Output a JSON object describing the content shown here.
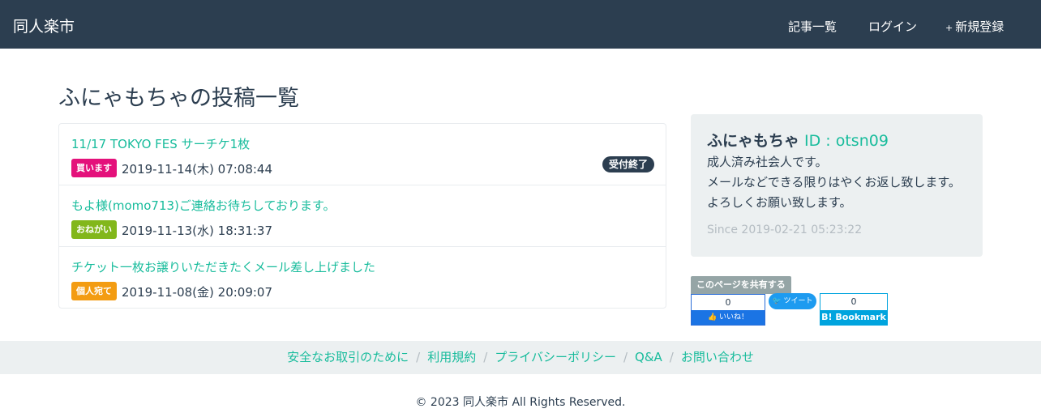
{
  "nav": {
    "brand": "同人楽市",
    "links": [
      {
        "icon": "",
        "label": "記事一覧",
        "icon_name": "list-icon"
      },
      {
        "icon": "",
        "label": "ログイン",
        "icon_name": "login-icon"
      },
      {
        "icon": "+",
        "label": "新規登録",
        "icon_name": "plus-icon"
      }
    ]
  },
  "page_title": "ふにゃもちゃの投稿一覧",
  "posts": [
    {
      "title": "11/17 TOKYO FES サーチケ1枚",
      "badge": "買います",
      "badge_color": "#e4117b",
      "date": "2019-11-14(木) 07:08:44",
      "status": "受付終了"
    },
    {
      "title": "もよ様(momo713)ご連絡お待ちしております。",
      "badge": "おねがい",
      "badge_color": "#82b71b",
      "date": "2019-11-13(水) 18:31:37",
      "status": ""
    },
    {
      "title": "チケット一枚お譲りいただきたくメール差し上げました",
      "badge": "個人宛て",
      "badge_color": "#f39c12",
      "date": "2019-11-08(金) 20:09:07",
      "status": ""
    }
  ],
  "profile": {
    "icon": "",
    "icon_name": "user-icon",
    "name": "ふにゃもちゃ",
    "user_id": "ID : otsn09",
    "bio": [
      "成人済み社会人です。",
      "メールなどできる限りはやくお返し致します。",
      "よろしくお願い致します。"
    ],
    "since_icon": "",
    "since_icon_name": "clock-icon",
    "since": "Since 2019-02-21 05:23:22"
  },
  "share": {
    "label": "このページを共有する",
    "facebook_count": "0",
    "facebook_label": "いいね！",
    "twitter_label": "ツイート",
    "hatena_count": "0",
    "hatena_label": "B! Bookmark"
  },
  "footer": {
    "links": [
      "安全なお取引のために",
      "利用規約",
      "プライバシーポリシー",
      "Q&A",
      "お問い合わせ"
    ],
    "separator": "/",
    "copyright": "© 2023 同人楽市 All Rights Reserved."
  },
  "colors": {
    "navbar": "#2c3e50",
    "accent": "#18bc9c",
    "panel": "#ecf0f1"
  }
}
